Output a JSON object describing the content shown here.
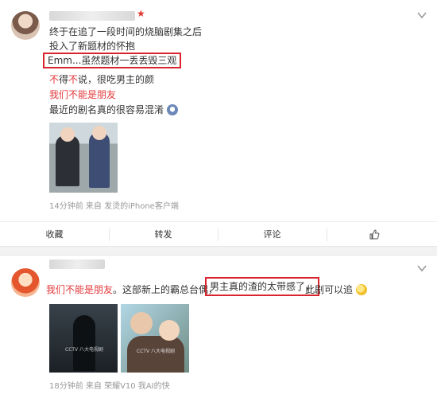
{
  "posts": [
    {
      "lines": [
        "终于在追了一段时间的烧脑剧集之后",
        "投入了新题材的怀抱",
        "Emm...虽然题材一丢丢毁三观",
        "不得不说，很吃男主的颜",
        "我们不能是朋友",
        "最近的剧名真的很容易混淆"
      ],
      "line4_red_1": "不",
      "line4_black_1": "得",
      "line4_red_2": "不",
      "line4_black_2": "说，很吃男主的颜",
      "meta": "14分钟前 来自 发烫的iPhone客户端"
    },
    {
      "text_red": "我们不能是朋友",
      "text_mid": "。这部新上的霸总台偶，",
      "text_boxed": "男主真的渣的太带感了，",
      "text_end": "此剧可以追",
      "meta": "18分钟前 来自 荣耀V10 我AI的快",
      "thumb_label_1": "CCTV 八大电视剧",
      "thumb_label_2": "CCTV 八大电视剧"
    }
  ],
  "actions": {
    "collect": "收藏",
    "repost": "转发",
    "comment": "评论"
  },
  "colors": {
    "accent_red": "#e4393c",
    "box_red": "#d9232d"
  },
  "icons": [
    "chevron-down-icon",
    "like-thumb-icon",
    "verified-star-icon"
  ]
}
